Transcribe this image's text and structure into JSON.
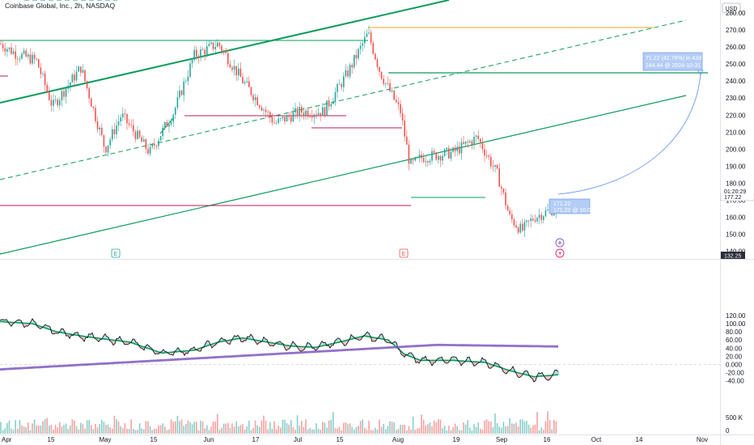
{
  "header": {
    "title": "Coinbase Global, Inc., 2h, NASDAQ",
    "currency": "USD"
  },
  "price_axis": {
    "labels": [
      "260.00",
      "250.00",
      "240.00",
      "230.00",
      "220.00",
      "210.00",
      "200.00",
      "190.00",
      "180.00",
      "170.00",
      "160.00",
      "150.00",
      "140.00"
    ],
    "top_label": "280.00",
    "label_270": "270.00",
    "current_price": "177.22",
    "countdown": "01:20:29",
    "mark_price": "132.25"
  },
  "oscillator_axis": {
    "labels": [
      "120.00",
      "100.00",
      "80.00",
      "60.00",
      "40.00",
      "20.00",
      "0.000",
      "-20.00",
      "-40.00"
    ],
    "volume_label": "500 K",
    "zero_label": "0"
  },
  "time_axis": {
    "labels": [
      "Apr",
      "15",
      "May",
      "15",
      "Jun",
      "17",
      "Jul",
      "15",
      "Aug",
      "19",
      "Sep",
      "16",
      "Oct",
      "14",
      "Nov"
    ]
  },
  "annotations": {
    "measure_target": "71.22 (42.76%) in 42d 4h",
    "measure_target_sub": "244.44 @ 2024-10-31 14:00",
    "measure_start": "171.22",
    "measure_start_sub": "171.22 @ 16:00",
    "earnings_markers": [
      "E",
      "E"
    ]
  },
  "colors": {
    "up": "#26a69a",
    "down": "#ef5350",
    "green_line": "#0b9c5a",
    "crimson_line": "#c2185b",
    "orange_line": "#f5a623",
    "blue_arc": "#5b8def",
    "purple_ma": "#7e57c2",
    "osc_black": "#131722"
  },
  "chart_data": {
    "type": "candlestick",
    "x": [
      "Apr",
      "15",
      "May",
      "15",
      "Jun",
      "17",
      "Jul",
      "15",
      "Aug",
      "19",
      "Sep",
      "16"
    ],
    "series": [
      {
        "name": "price",
        "values": [
          262,
          256,
          252,
          225,
          248,
          251,
          222,
          230,
          270,
          232,
          198,
          212,
          160,
          166
        ]
      }
    ],
    "ylim": [
      140,
      280
    ],
    "horizontal_levels": [
      271,
      244,
      211,
      166,
      170
    ],
    "projection": {
      "start": 171.22,
      "target": 244.44,
      "change": "71.22 (42.76%)"
    }
  }
}
